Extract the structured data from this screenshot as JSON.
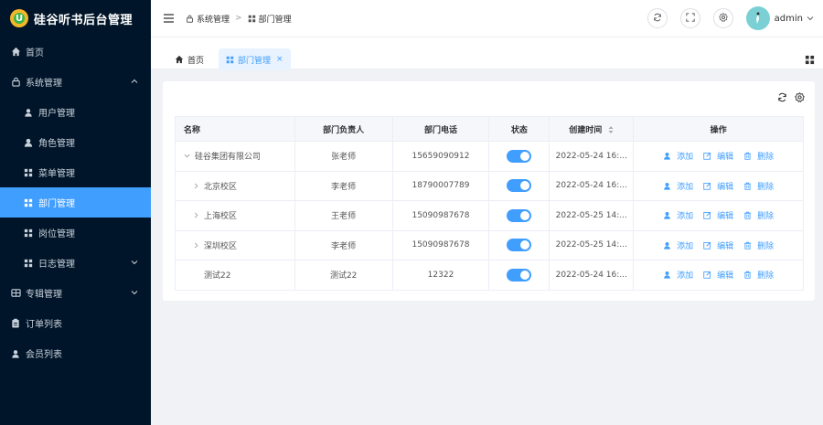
{
  "app": {
    "title": "硅谷听书后台管理",
    "logo_letter": "U"
  },
  "sidebar": {
    "items": [
      {
        "label": "首页",
        "icon": "home-icon"
      },
      {
        "label": "系统管理",
        "icon": "lock-icon",
        "expanded": true
      },
      {
        "label": "用户管理",
        "icon": "user-icon"
      },
      {
        "label": "角色管理",
        "icon": "user-filled-icon"
      },
      {
        "label": "菜单管理",
        "icon": "grid-icon"
      },
      {
        "label": "部门管理",
        "icon": "grid-icon",
        "active": true
      },
      {
        "label": "岗位管理",
        "icon": "grid-icon"
      },
      {
        "label": "日志管理",
        "icon": "grid-icon"
      },
      {
        "label": "专辑管理",
        "icon": "album-icon"
      },
      {
        "label": "订单列表",
        "icon": "clipboard-icon"
      },
      {
        "label": "会员列表",
        "icon": "user-icon"
      }
    ]
  },
  "header": {
    "breadcrumb": [
      "系统管理",
      "部门管理"
    ],
    "username": "admin"
  },
  "tabs": [
    {
      "label": "首页",
      "icon": "home-icon"
    },
    {
      "label": "部门管理",
      "icon": "grid-icon",
      "active": true,
      "close": "×"
    }
  ],
  "table": {
    "columns": [
      "名称",
      "部门负责人",
      "部门电话",
      "状态",
      "创建时间",
      "操作"
    ],
    "rows": [
      {
        "name": "硅谷集团有限公司",
        "leader": "张老师",
        "phone": "15659090912",
        "status": true,
        "created": "2022-05-24 16:...",
        "level": 0,
        "expand": "down"
      },
      {
        "name": "北京校区",
        "leader": "李老师",
        "phone": "18790007789",
        "status": true,
        "created": "2022-05-24 16:...",
        "level": 1,
        "expand": "right"
      },
      {
        "name": "上海校区",
        "leader": "王老师",
        "phone": "15090987678",
        "status": true,
        "created": "2022-05-25 14:...",
        "level": 1,
        "expand": "right"
      },
      {
        "name": "深圳校区",
        "leader": "李老师",
        "phone": "15090987678",
        "status": true,
        "created": "2022-05-25 14:...",
        "level": 1,
        "expand": "right"
      },
      {
        "name": "测试22",
        "leader": "测试22",
        "phone": "12322",
        "status": true,
        "created": "2022-05-24 16:...",
        "level": 1,
        "expand": "none"
      }
    ],
    "actions": {
      "add": "添加",
      "edit": "编辑",
      "delete": "删除"
    }
  },
  "colors": {
    "sidebar_bg": "#001529",
    "accent": "#409eff",
    "tab_active_bg": "#e8f3ff"
  }
}
